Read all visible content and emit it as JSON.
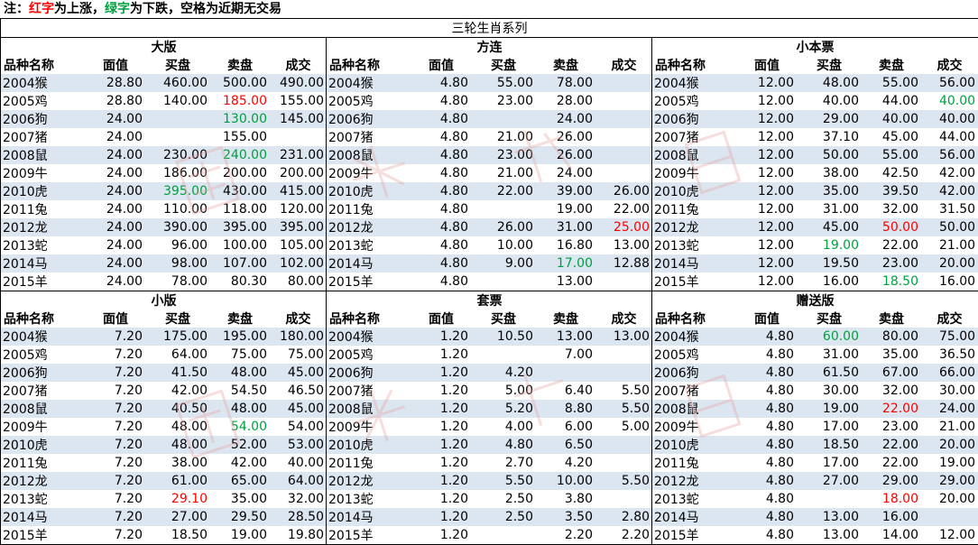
{
  "note": {
    "prefix": "注：",
    "red": "红字",
    "mid": "为上涨，",
    "green": "绿字",
    "suffix": "为下跌，空格为近期无交易"
  },
  "title": "三轮生肖系列",
  "headers": [
    "品种名称",
    "面值",
    "买盘",
    "卖盘",
    "成交"
  ],
  "colors": {
    "up": "#ff0000",
    "down": "#00a040",
    "band": "#dce6f1"
  },
  "sections": [
    {
      "name": "大版",
      "rows": [
        [
          "2004猴",
          "28.80",
          "460.00",
          "500.00",
          "490.00"
        ],
        [
          "2005鸡",
          "28.80",
          "140.00",
          "185.00",
          "155.00"
        ],
        [
          "2006狗",
          "24.00",
          "",
          "130.00",
          "145.00"
        ],
        [
          "2007猪",
          "24.00",
          "",
          "155.00",
          ""
        ],
        [
          "2008鼠",
          "24.00",
          "230.00",
          "240.00",
          "231.00"
        ],
        [
          "2009牛",
          "24.00",
          "186.00",
          "200.00",
          "200.00"
        ],
        [
          "2010虎",
          "24.00",
          "395.00",
          "430.00",
          "415.00"
        ],
        [
          "2011兔",
          "24.00",
          "110.00",
          "118.00",
          "120.00"
        ],
        [
          "2012龙",
          "24.00",
          "390.00",
          "395.00",
          "395.00"
        ],
        [
          "2013蛇",
          "24.00",
          "96.00",
          "100.00",
          "105.00"
        ],
        [
          "2014马",
          "24.00",
          "98.00",
          "107.00",
          "102.00"
        ],
        [
          "2015羊",
          "24.00",
          "78.00",
          "80.30",
          "80.00"
        ]
      ],
      "marks": {
        "1-3": "up",
        "2-3": "down",
        "4-3": "down",
        "6-2": "down"
      }
    },
    {
      "name": "方连",
      "rows": [
        [
          "2004猴",
          "4.80",
          "55.00",
          "78.00",
          ""
        ],
        [
          "2005鸡",
          "4.80",
          "23.00",
          "28.00",
          ""
        ],
        [
          "2006狗",
          "4.80",
          "",
          "24.00",
          ""
        ],
        [
          "2007猪",
          "4.80",
          "21.00",
          "26.00",
          ""
        ],
        [
          "2008鼠",
          "4.80",
          "23.00",
          "26.00",
          ""
        ],
        [
          "2009牛",
          "4.80",
          "21.00",
          "24.00",
          ""
        ],
        [
          "2010虎",
          "4.80",
          "22.00",
          "39.00",
          "26.00"
        ],
        [
          "2011兔",
          "4.80",
          "",
          "19.00",
          "22.00"
        ],
        [
          "2012龙",
          "4.80",
          "26.00",
          "31.00",
          "25.00"
        ],
        [
          "2013蛇",
          "4.80",
          "10.00",
          "16.80",
          "13.00"
        ],
        [
          "2014马",
          "4.80",
          "9.00",
          "17.00",
          "12.88"
        ],
        [
          "2015羊",
          "4.80",
          "",
          "13.00",
          ""
        ]
      ],
      "marks": {
        "8-4": "up",
        "10-3": "down"
      }
    },
    {
      "name": "小本票",
      "rows": [
        [
          "2004猴",
          "12.00",
          "48.00",
          "55.00",
          "56.00"
        ],
        [
          "2005鸡",
          "12.00",
          "40.00",
          "44.00",
          "40.00"
        ],
        [
          "2006狗",
          "12.00",
          "29.00",
          "40.00",
          "40.00"
        ],
        [
          "2007猪",
          "12.00",
          "37.10",
          "45.00",
          "44.00"
        ],
        [
          "2008鼠",
          "12.00",
          "50.00",
          "55.00",
          "56.00"
        ],
        [
          "2009牛",
          "12.00",
          "38.00",
          "42.50",
          "42.00"
        ],
        [
          "2010虎",
          "12.00",
          "35.00",
          "39.50",
          "42.00"
        ],
        [
          "2011兔",
          "12.00",
          "31.00",
          "32.00",
          "31.50"
        ],
        [
          "2012龙",
          "12.00",
          "45.00",
          "50.00",
          "50.00"
        ],
        [
          "2013蛇",
          "12.00",
          "19.00",
          "22.00",
          "21.00"
        ],
        [
          "2014马",
          "12.00",
          "19.50",
          "23.00",
          "20.00"
        ],
        [
          "2015羊",
          "12.00",
          "16.00",
          "18.50",
          "16.00"
        ]
      ],
      "marks": {
        "1-4": "down",
        "8-3": "up",
        "9-2": "down",
        "11-3": "down"
      }
    },
    {
      "name": "小版",
      "rows": [
        [
          "2004猴",
          "7.20",
          "175.00",
          "195.00",
          "180.00"
        ],
        [
          "2005鸡",
          "7.20",
          "64.00",
          "75.00",
          "75.00"
        ],
        [
          "2006狗",
          "7.20",
          "41.50",
          "48.00",
          "45.00"
        ],
        [
          "2007猪",
          "7.20",
          "42.00",
          "54.50",
          "46.50"
        ],
        [
          "2008鼠",
          "7.20",
          "40.50",
          "48.00",
          "45.00"
        ],
        [
          "2009牛",
          "7.20",
          "48.00",
          "54.00",
          "54.00"
        ],
        [
          "2010虎",
          "7.20",
          "48.00",
          "52.00",
          "53.00"
        ],
        [
          "2011兔",
          "7.20",
          "38.00",
          "42.00",
          "40.00"
        ],
        [
          "2012龙",
          "7.20",
          "61.00",
          "65.00",
          "64.00"
        ],
        [
          "2013蛇",
          "7.20",
          "29.10",
          "35.00",
          "32.00"
        ],
        [
          "2014马",
          "7.20",
          "27.00",
          "29.50",
          "28.50"
        ],
        [
          "2015羊",
          "7.20",
          "18.50",
          "19.00",
          "19.80"
        ]
      ],
      "marks": {
        "5-3": "down",
        "9-2": "up"
      }
    },
    {
      "name": "套票",
      "rows": [
        [
          "2004猴",
          "1.20",
          "10.50",
          "13.00",
          "13.00"
        ],
        [
          "2005鸡",
          "1.20",
          "",
          "7.00",
          ""
        ],
        [
          "2006狗",
          "1.20",
          "4.20",
          "",
          ""
        ],
        [
          "2007猪",
          "1.20",
          "5.00",
          "6.40",
          "5.50"
        ],
        [
          "2008鼠",
          "1.20",
          "5.20",
          "8.80",
          "5.50"
        ],
        [
          "2009牛",
          "1.20",
          "4.00",
          "6.00",
          "5.00"
        ],
        [
          "2010虎",
          "1.20",
          "4.80",
          "6.50",
          ""
        ],
        [
          "2011兔",
          "1.20",
          "2.70",
          "4.20",
          ""
        ],
        [
          "2012龙",
          "1.20",
          "5.50",
          "10.00",
          "5.50"
        ],
        [
          "2013蛇",
          "1.20",
          "2.50",
          "3.80",
          ""
        ],
        [
          "2014马",
          "1.20",
          "2.50",
          "3.50",
          "2.80"
        ],
        [
          "2015羊",
          "1.20",
          "",
          "2.20",
          "2.20"
        ]
      ],
      "marks": {}
    },
    {
      "name": "赠送版",
      "rows": [
        [
          "2004猴",
          "4.80",
          "60.00",
          "80.00",
          "75.00"
        ],
        [
          "2005鸡",
          "4.80",
          "31.00",
          "35.00",
          "36.50"
        ],
        [
          "2006狗",
          "4.80",
          "61.50",
          "67.00",
          "66.00"
        ],
        [
          "2007猪",
          "4.80",
          "30.00",
          "32.00",
          "30.00"
        ],
        [
          "2008鼠",
          "4.80",
          "19.00",
          "22.00",
          "24.00"
        ],
        [
          "2009牛",
          "4.80",
          "17.00",
          "23.00",
          "21.00"
        ],
        [
          "2010虎",
          "4.80",
          "18.50",
          "22.00",
          "20.00"
        ],
        [
          "2011兔",
          "4.80",
          "17.00",
          "22.00",
          "19.00"
        ],
        [
          "2012龙",
          "4.80",
          "27.00",
          "29.00",
          "29.00"
        ],
        [
          "2013蛇",
          "4.80",
          "",
          "18.00",
          "20.00"
        ],
        [
          "2014马",
          "4.80",
          "13.00",
          "16.00",
          ""
        ],
        [
          "2015羊",
          "4.80",
          "13.00",
          "14.00",
          "12.00"
        ]
      ],
      "marks": {
        "0-2": "down",
        "4-3": "up",
        "9-3": "up"
      }
    }
  ]
}
